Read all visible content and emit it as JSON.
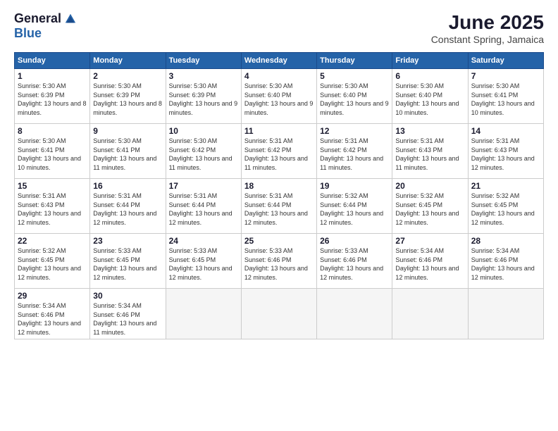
{
  "logo": {
    "general": "General",
    "blue": "Blue"
  },
  "header": {
    "month": "June 2025",
    "location": "Constant Spring, Jamaica"
  },
  "weekdays": [
    "Sunday",
    "Monday",
    "Tuesday",
    "Wednesday",
    "Thursday",
    "Friday",
    "Saturday"
  ],
  "weeks": [
    [
      {
        "day": "1",
        "sunrise": "5:30 AM",
        "sunset": "6:39 PM",
        "daylight": "13 hours and 8 minutes."
      },
      {
        "day": "2",
        "sunrise": "5:30 AM",
        "sunset": "6:39 PM",
        "daylight": "13 hours and 8 minutes."
      },
      {
        "day": "3",
        "sunrise": "5:30 AM",
        "sunset": "6:39 PM",
        "daylight": "13 hours and 9 minutes."
      },
      {
        "day": "4",
        "sunrise": "5:30 AM",
        "sunset": "6:40 PM",
        "daylight": "13 hours and 9 minutes."
      },
      {
        "day": "5",
        "sunrise": "5:30 AM",
        "sunset": "6:40 PM",
        "daylight": "13 hours and 9 minutes."
      },
      {
        "day": "6",
        "sunrise": "5:30 AM",
        "sunset": "6:40 PM",
        "daylight": "13 hours and 10 minutes."
      },
      {
        "day": "7",
        "sunrise": "5:30 AM",
        "sunset": "6:41 PM",
        "daylight": "13 hours and 10 minutes."
      }
    ],
    [
      {
        "day": "8",
        "sunrise": "5:30 AM",
        "sunset": "6:41 PM",
        "daylight": "13 hours and 10 minutes."
      },
      {
        "day": "9",
        "sunrise": "5:30 AM",
        "sunset": "6:41 PM",
        "daylight": "13 hours and 11 minutes."
      },
      {
        "day": "10",
        "sunrise": "5:30 AM",
        "sunset": "6:42 PM",
        "daylight": "13 hours and 11 minutes."
      },
      {
        "day": "11",
        "sunrise": "5:31 AM",
        "sunset": "6:42 PM",
        "daylight": "13 hours and 11 minutes."
      },
      {
        "day": "12",
        "sunrise": "5:31 AM",
        "sunset": "6:42 PM",
        "daylight": "13 hours and 11 minutes."
      },
      {
        "day": "13",
        "sunrise": "5:31 AM",
        "sunset": "6:43 PM",
        "daylight": "13 hours and 11 minutes."
      },
      {
        "day": "14",
        "sunrise": "5:31 AM",
        "sunset": "6:43 PM",
        "daylight": "13 hours and 12 minutes."
      }
    ],
    [
      {
        "day": "15",
        "sunrise": "5:31 AM",
        "sunset": "6:43 PM",
        "daylight": "13 hours and 12 minutes."
      },
      {
        "day": "16",
        "sunrise": "5:31 AM",
        "sunset": "6:44 PM",
        "daylight": "13 hours and 12 minutes."
      },
      {
        "day": "17",
        "sunrise": "5:31 AM",
        "sunset": "6:44 PM",
        "daylight": "13 hours and 12 minutes."
      },
      {
        "day": "18",
        "sunrise": "5:31 AM",
        "sunset": "6:44 PM",
        "daylight": "13 hours and 12 minutes."
      },
      {
        "day": "19",
        "sunrise": "5:32 AM",
        "sunset": "6:44 PM",
        "daylight": "13 hours and 12 minutes."
      },
      {
        "day": "20",
        "sunrise": "5:32 AM",
        "sunset": "6:45 PM",
        "daylight": "13 hours and 12 minutes."
      },
      {
        "day": "21",
        "sunrise": "5:32 AM",
        "sunset": "6:45 PM",
        "daylight": "13 hours and 12 minutes."
      }
    ],
    [
      {
        "day": "22",
        "sunrise": "5:32 AM",
        "sunset": "6:45 PM",
        "daylight": "13 hours and 12 minutes."
      },
      {
        "day": "23",
        "sunrise": "5:33 AM",
        "sunset": "6:45 PM",
        "daylight": "13 hours and 12 minutes."
      },
      {
        "day": "24",
        "sunrise": "5:33 AM",
        "sunset": "6:45 PM",
        "daylight": "13 hours and 12 minutes."
      },
      {
        "day": "25",
        "sunrise": "5:33 AM",
        "sunset": "6:46 PM",
        "daylight": "13 hours and 12 minutes."
      },
      {
        "day": "26",
        "sunrise": "5:33 AM",
        "sunset": "6:46 PM",
        "daylight": "13 hours and 12 minutes."
      },
      {
        "day": "27",
        "sunrise": "5:34 AM",
        "sunset": "6:46 PM",
        "daylight": "13 hours and 12 minutes."
      },
      {
        "day": "28",
        "sunrise": "5:34 AM",
        "sunset": "6:46 PM",
        "daylight": "13 hours and 12 minutes."
      }
    ],
    [
      {
        "day": "29",
        "sunrise": "5:34 AM",
        "sunset": "6:46 PM",
        "daylight": "13 hours and 12 minutes."
      },
      {
        "day": "30",
        "sunrise": "5:34 AM",
        "sunset": "6:46 PM",
        "daylight": "13 hours and 11 minutes."
      },
      null,
      null,
      null,
      null,
      null
    ]
  ]
}
